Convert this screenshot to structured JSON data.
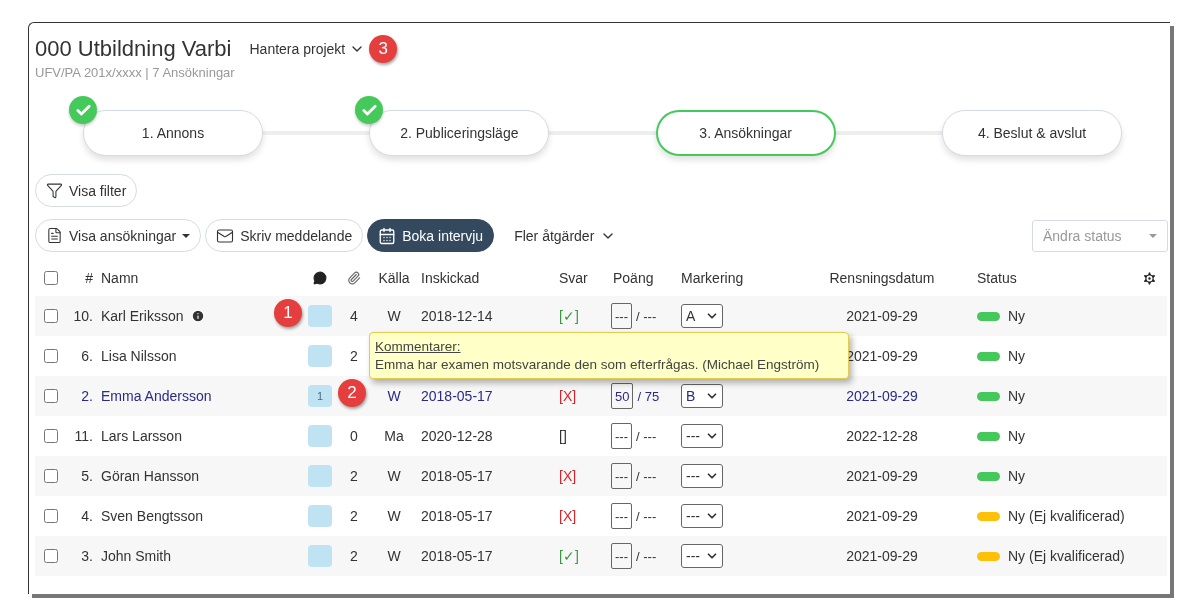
{
  "header": {
    "title": "000 Utbildning Varbi",
    "subtitle": "UFV/PA 201x/xxxx | 7 Ansökningar",
    "menu": "Hantera projekt",
    "callout": "3"
  },
  "steps": [
    {
      "label": "1. Annons",
      "done": true,
      "selected": false
    },
    {
      "label": "2. Publiceringsläge",
      "done": true,
      "selected": false
    },
    {
      "label": "3. Ansökningar",
      "done": false,
      "selected": true
    },
    {
      "label": "4. Beslut & avslut",
      "done": false,
      "selected": false
    }
  ],
  "filter_button": "Visa filter",
  "toolbar": {
    "view_button": "Visa ansökningar",
    "message_button": "Skriv meddelande",
    "interview_button": "Boka intervju",
    "more_menu": "Fler åtgärder",
    "status_select": {
      "placeholder": "Ändra status"
    }
  },
  "table": {
    "columns": {
      "checked": false,
      "number": "#",
      "name": "Namn",
      "source": "Källa",
      "submitted": "Inskickad",
      "answer": "Svar",
      "score": "Poäng",
      "marking": "Markering",
      "purge_date": "Rensningsdatum",
      "status": "Status"
    },
    "rows": [
      {
        "checked": false,
        "number": "10.",
        "name": "Karl Eriksson",
        "info": true,
        "highlighted": false,
        "callout": "1",
        "attachments": "4",
        "source": "W",
        "submitted": "2018-12-14",
        "answer": {
          "text": "[✓]",
          "kind": "yes"
        },
        "score": "---",
        "max": "/ ---",
        "marking": "A",
        "purge_date": "2021-09-29",
        "status": {
          "label": "Ny",
          "color": "#44c95a"
        }
      },
      {
        "checked": false,
        "number": "6.",
        "name": "Lisa Nilsson",
        "info": false,
        "highlighted": false,
        "attachments": "2",
        "purge_date": "2021-09-29",
        "status": {
          "label": "Ny",
          "color": "#44c95a"
        }
      },
      {
        "checked": false,
        "number": "2.",
        "name": "Emma Andersson",
        "info": false,
        "highlighted": true,
        "comment_count": "1",
        "callout": "2",
        "source": "W",
        "submitted": "2018-05-17",
        "answer": {
          "text": "[X]",
          "kind": "no"
        },
        "score": "50",
        "max": "/ 75",
        "marking": "B",
        "purge_date": "2021-09-29",
        "status": {
          "label": "Ny",
          "color": "#44c95a"
        }
      },
      {
        "checked": false,
        "number": "11.",
        "name": "Lars Larsson",
        "info": false,
        "highlighted": false,
        "attachments": "0",
        "source": "Ma",
        "submitted": "2020-12-28",
        "answer": {
          "text": "[]",
          "kind": "none"
        },
        "score": "---",
        "max": "/ ---",
        "marking": "---",
        "purge_date": "2022-12-28",
        "status": {
          "label": "Ny",
          "color": "#44c95a"
        }
      },
      {
        "checked": false,
        "number": "5.",
        "name": "Göran Hansson",
        "info": false,
        "highlighted": false,
        "attachments": "2",
        "source": "W",
        "submitted": "2018-05-17",
        "answer": {
          "text": "[X]",
          "kind": "no"
        },
        "score": "---",
        "max": "/ ---",
        "marking": "---",
        "purge_date": "2021-09-29",
        "status": {
          "label": "Ny",
          "color": "#44c95a"
        }
      },
      {
        "checked": false,
        "number": "4.",
        "name": "Sven Bengtsson",
        "info": false,
        "highlighted": false,
        "attachments": "2",
        "source": "W",
        "submitted": "2018-05-17",
        "answer": {
          "text": "[X]",
          "kind": "no"
        },
        "score": "---",
        "max": "/ ---",
        "marking": "---",
        "purge_date": "2021-09-29",
        "status": {
          "label": "Ny (Ej kvalificerad)",
          "color": "#ffc107"
        }
      },
      {
        "checked": false,
        "number": "3.",
        "name": "John Smith",
        "info": false,
        "highlighted": false,
        "attachments": "2",
        "source": "W",
        "submitted": "2018-05-17",
        "answer": {
          "text": "[✓]",
          "kind": "yes"
        },
        "score": "---",
        "max": "/ ---",
        "marking": "---",
        "purge_date": "2021-09-29",
        "status": {
          "label": "Ny (Ej kvalificerad)",
          "color": "#ffc107"
        }
      }
    ],
    "tooltip": {
      "title": "Kommentarer:",
      "text": "Emma har examen motsvarande den som efterfrågas. (Michael Engström)"
    }
  }
}
